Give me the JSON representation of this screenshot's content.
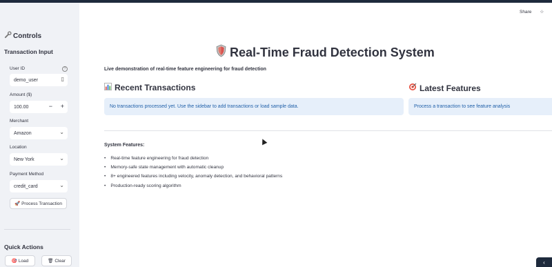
{
  "sidebar": {
    "title": "Controls",
    "transaction_input_heading": "Transaction Input",
    "user_id": {
      "label": "User ID",
      "value": "demo_user"
    },
    "amount": {
      "label": "Amount ($)",
      "value": "100.00",
      "minus": "−",
      "plus": "+"
    },
    "merchant": {
      "label": "Merchant",
      "value": "Amazon"
    },
    "location": {
      "label": "Location",
      "value": "New York"
    },
    "payment_method": {
      "label": "Payment Method",
      "value": "credit_card"
    },
    "process_button": "Process Transaction",
    "quick_actions_heading": "Quick Actions",
    "load_button": "Load",
    "clear_button": "Clear"
  },
  "header": {
    "share": "Share"
  },
  "main": {
    "title": "Real-Time Fraud Detection System",
    "subtitle": "Live demonstration of real-time feature engineering for fraud detection",
    "recent_transactions": {
      "heading": "Recent Transactions",
      "info": "No transactions processed yet. Use the sidebar to add transactions or load sample data."
    },
    "latest_features": {
      "heading": "Latest Features",
      "info": "Process a transaction to see feature analysis"
    },
    "system_features": {
      "heading": "System Features:",
      "items": [
        "Real-time feature engineering for fraud detection",
        "Memory-safe state management with automatic cleanup",
        "8+ engineered features including velocity, anomaly detection, and behavioral patterns",
        "Production-ready scoring algorithm"
      ]
    }
  },
  "icons": {
    "controls": "wrench-icon",
    "title": "shield-icon",
    "recent": "bar-chart-icon",
    "features": "target-icon",
    "process": "rocket-icon",
    "load": "target-icon",
    "clear": "trash-icon"
  },
  "colors": {
    "sidebar_bg": "#f0f2f6",
    "info_bg": "#e6effa",
    "info_text": "#1f5fa8",
    "topbar": "#1e2a3c"
  }
}
